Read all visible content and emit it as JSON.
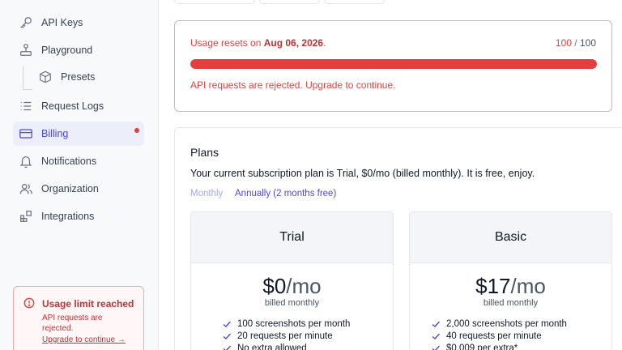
{
  "sidebar": {
    "items": [
      {
        "label": "API Keys",
        "icon": "key-icon"
      },
      {
        "label": "Playground",
        "icon": "joystick-icon"
      },
      {
        "label": "Presets",
        "icon": "cube-icon"
      },
      {
        "label": "Request Logs",
        "icon": "list-icon"
      },
      {
        "label": "Billing",
        "icon": "credit-card-icon",
        "active": true
      },
      {
        "label": "Notifications",
        "icon": "bell-icon"
      },
      {
        "label": "Organization",
        "icon": "users-icon"
      },
      {
        "label": "Integrations",
        "icon": "grid-plus-icon"
      }
    ],
    "limit": {
      "title": "Usage limit reached",
      "text": "API requests are rejected.",
      "link": "Upgrade to continue →"
    }
  },
  "usage": {
    "prefix": "Usage resets on ",
    "date": "Aug 06, 2026",
    "suffix": ".",
    "used": "100",
    "sep": "/",
    "total": "100",
    "progress_fraction": 1.0,
    "message": "API requests are rejected. Upgrade to continue."
  },
  "plans": {
    "title": "Plans",
    "subtitle": "Your current subscription plan is Trial, $0/mo (billed monthly). It is free, enjoy.",
    "toggle_monthly": "Monthly",
    "toggle_annually": "Annually (2 months free)",
    "cards": [
      {
        "name": "Trial",
        "price": "$0",
        "unit": "/mo",
        "billed": "billed monthly",
        "features": [
          "100 screenshots per month",
          "20 requests per minute",
          "No extra allowed"
        ]
      },
      {
        "name": "Basic",
        "price": "$17",
        "unit": "/mo",
        "billed": "billed monthly",
        "features": [
          "2,000 screenshots per month",
          "40 requests per minute",
          "$0.009 per extra*"
        ]
      }
    ]
  },
  "colors": {
    "accent": "#4f46e5",
    "danger": "#e53e3e"
  }
}
